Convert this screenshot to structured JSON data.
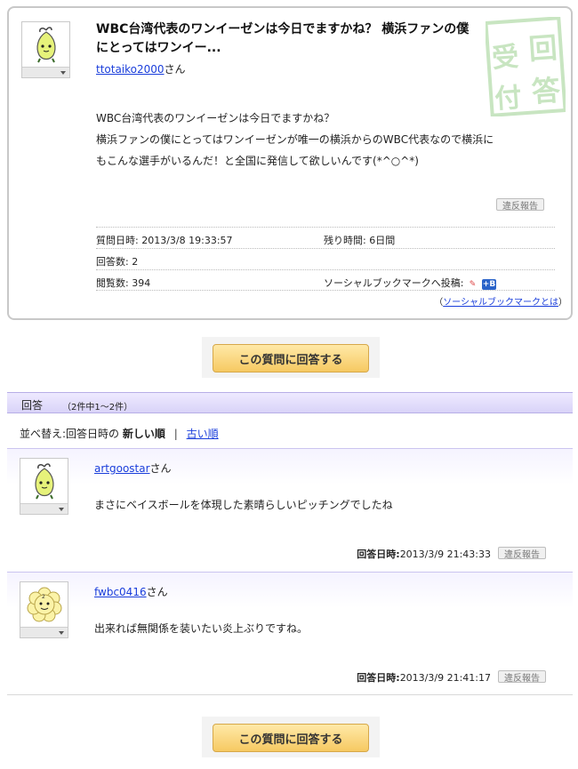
{
  "question": {
    "title": "WBC台湾代表のワンイーゼンは今日でますかね？ 横浜ファンの僕にとってはワンイー...",
    "user": "ttotaiko2000",
    "user_suffix": "さん",
    "body_lines": [
      "WBC台湾代表のワンイーゼンは今日でますかね？",
      "横浜ファンの僕にとってはワンイーゼンが唯一の横浜からのWBC代表なので横浜に",
      "もこんな選手がいるんだ！と全国に発信して欲しいんです(*^○^*)"
    ],
    "stamp_text": "受付回答",
    "report_label": "違反報告",
    "meta": {
      "asked_label": "質問日時:",
      "asked_value": "2013/3/8 19:33:57",
      "remaining_label": "残り時間:",
      "remaining_value": "6日間",
      "answers_label": "回答数:",
      "answers_value": "2",
      "views_label": "閲覧数:",
      "views_value": "394",
      "social_label": "ソーシャルブックマークへ投稿:",
      "social_icon_1": "✎",
      "social_icon_2": "+B"
    },
    "social_help_link": "ソーシャルブックマークとは"
  },
  "answer_button_label": "この質問に回答する",
  "answers_header": {
    "title": "回答",
    "count": "（2件中1～2件）"
  },
  "sort": {
    "prefix": "並べ替え:回答日時の",
    "current": "新しい順",
    "separator": "|",
    "other": "古い順"
  },
  "answers": [
    {
      "user": "artgoostar",
      "user_suffix": "さん",
      "text": "まさにベイスボールを体現した素晴らしいピッチングでしたね",
      "date_label": "回答日時:",
      "date": "2013/3/9 21:43:33",
      "report_label": "違反報告"
    },
    {
      "user": "fwbc0416",
      "user_suffix": "さん",
      "text": "出来れば無関係を装いたい炎上ぶりですね。",
      "date_label": "回答日時:",
      "date": "2013/3/9 21:41:17",
      "report_label": "違反報告"
    }
  ],
  "colors": {
    "link": "#1a3edb",
    "header_purple": "#d9d3f8",
    "button_gold": "#f6c962",
    "stamp_green": "#9bcf8f"
  }
}
